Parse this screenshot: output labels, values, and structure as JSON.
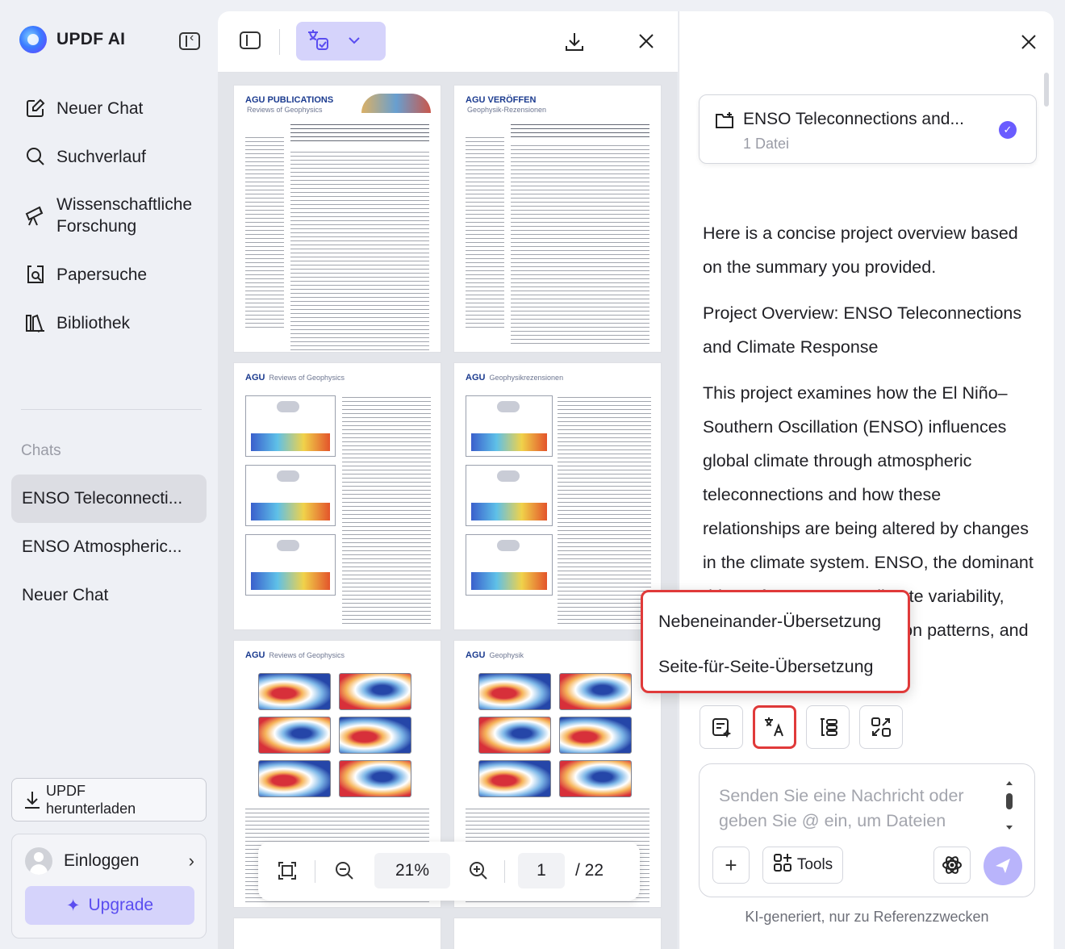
{
  "app": {
    "brand": "UPDF AI"
  },
  "sidebar": {
    "nav": [
      {
        "label": "Neuer Chat",
        "icon": "new-chat-icon"
      },
      {
        "label": "Suchverlauf",
        "icon": "search-icon"
      },
      {
        "label": "Wissenschaftliche Forschung",
        "icon": "telescope-icon"
      },
      {
        "label": "Papersuche",
        "icon": "paper-search-icon"
      },
      {
        "label": "Bibliothek",
        "icon": "library-icon"
      }
    ],
    "chats_label": "Chats",
    "chats": [
      "ENSO Teleconnecti...",
      "ENSO Atmospheric...",
      "Neuer Chat"
    ],
    "download_label": "UPDF herunterladen",
    "login_label": "Einloggen",
    "upgrade_label": "Upgrade"
  },
  "document": {
    "pages": [
      {
        "header": "AGU PUBLICATIONS",
        "sub": "Reviews of Geophysics"
      },
      {
        "header": "AGU VERÖFFEN",
        "sub": "Geophysik-Rezensionen"
      },
      {
        "header": "AGU",
        "sub": "Reviews of Geophysics"
      },
      {
        "header": "AGU",
        "sub": "Geophysikrezensionen"
      },
      {
        "header": "AGU",
        "sub": "Reviews of Geophysics"
      },
      {
        "header": "AGU",
        "sub": "Geophysik"
      }
    ],
    "zoom": "21%",
    "current_page": "1",
    "total_pages": "/ 22"
  },
  "chat": {
    "file": {
      "title": "ENSO Teleconnections and...",
      "count": "1 Datei"
    },
    "messages": {
      "p1": "Here is a concise project overview based on the summary you provided.",
      "p2": "Project Overview: ENSO Teleconnections and Climate Response",
      "p3": "This project examines how the El Niño–Southern Oscillation (ENSO) influences global climate through atmospheric teleconnections and how these relationships are being altered by changes in the climate system. ENSO, the dominant driver of year-to-year climate variability, affects weather, precipitation patterns, and extreme"
    },
    "composer_placeholder": "Senden Sie eine Nachricht oder geben Sie @ ein, um Dateien",
    "tools_label": "Tools",
    "disclaimer": "KI-generiert, nur zu Referenzzwecken"
  },
  "translate_menu": {
    "items": [
      "Nebeneinander-Übersetzung",
      "Seite-für-Seite-Übersetzung"
    ]
  },
  "colors": {
    "accent": "#6a5cff",
    "accent_light": "#d5d3fb",
    "highlight": "#e03a3a"
  }
}
